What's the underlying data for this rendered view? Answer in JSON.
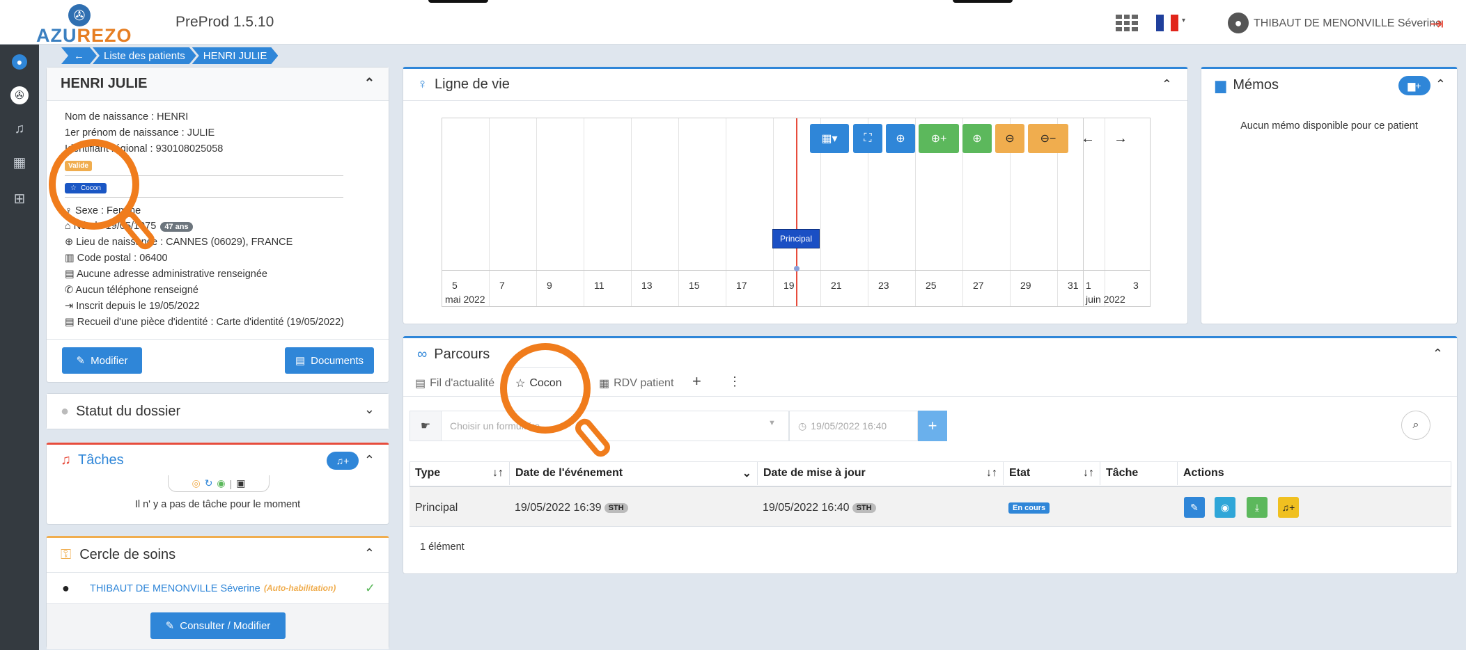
{
  "header": {
    "logo_text_a": "AZU",
    "logo_text_b": "REZO",
    "version": "PreProd 1.5.10",
    "user_name": "THIBAUT DE MENONVILLE Séverine"
  },
  "breadcrumb": {
    "back": "←",
    "items": [
      "Liste des patients",
      "HENRI JULIE"
    ]
  },
  "patient": {
    "title": "HENRI JULIE",
    "birth_name": "Nom de naissance : HENRI",
    "first_name": "1er prénom de naissance : JULIE",
    "regional_id": "Identifiant régional : 930108025058",
    "status_badge": "Valide",
    "program_badge": "Cocon",
    "sex": "Sexe : Femme",
    "born": "Née le 19/05/1975",
    "age": "47 ans",
    "birthplace": "Lieu de naissance : CANNES (06029), FRANCE",
    "postal": "Code postal : 06400",
    "address": "Aucune adresse administrative renseignée",
    "phone": "Aucun téléphone renseigné",
    "registered": "Inscrit depuis le 19/05/2022",
    "id_doc": "Recueil d'une pièce d'identité : Carte d'identité (19/05/2022)",
    "modify_label": "Modifier",
    "documents_label": "Documents"
  },
  "statut": {
    "title": "Statut du dossier"
  },
  "taches": {
    "title": "Tâches",
    "empty": "Il n' y a pas de tâche pour le moment"
  },
  "cercle": {
    "title": "Cercle de soins",
    "member": "THIBAUT DE MENONVILLE Séverine",
    "member_note": "(Auto-habilitation)",
    "button": "Consulter / Modifier"
  },
  "ligne_de_vie": {
    "title": "Ligne de vie",
    "event_label": "Principal",
    "ticks": [
      "5",
      "7",
      "9",
      "11",
      "13",
      "15",
      "17",
      "19",
      "21",
      "23",
      "25",
      "27",
      "29",
      "31",
      "1",
      "3"
    ],
    "month_a": "mai 2022",
    "month_b": "juin 2022",
    "nav_prev": "←",
    "nav_next": "→"
  },
  "memos": {
    "title": "Mémos",
    "empty": "Aucun mémo disponible pour ce patient"
  },
  "parcours": {
    "title": "Parcours",
    "tabs": [
      "Fil d'actualité",
      "Cocon",
      "RDV patient"
    ],
    "form_placeholder": "Choisir un formulaire",
    "date_value": "19/05/2022 16:40",
    "columns": [
      "Type",
      "Date de l'événement",
      "Date de mise à jour",
      "Etat",
      "Tâche",
      "Actions"
    ],
    "rows": [
      {
        "type": "Principal",
        "event_date": "19/05/2022 16:39",
        "event_user": "STH",
        "update_date": "19/05/2022 16:40",
        "update_user": "STH",
        "etat": "En cours",
        "tache": ""
      }
    ],
    "count": "1 élément"
  },
  "colors": {
    "primary": "#2f86d8",
    "success": "#5cb85c",
    "warning": "#f0ad4e",
    "highlight": "#f07c1c",
    "dark": "#343a40"
  }
}
